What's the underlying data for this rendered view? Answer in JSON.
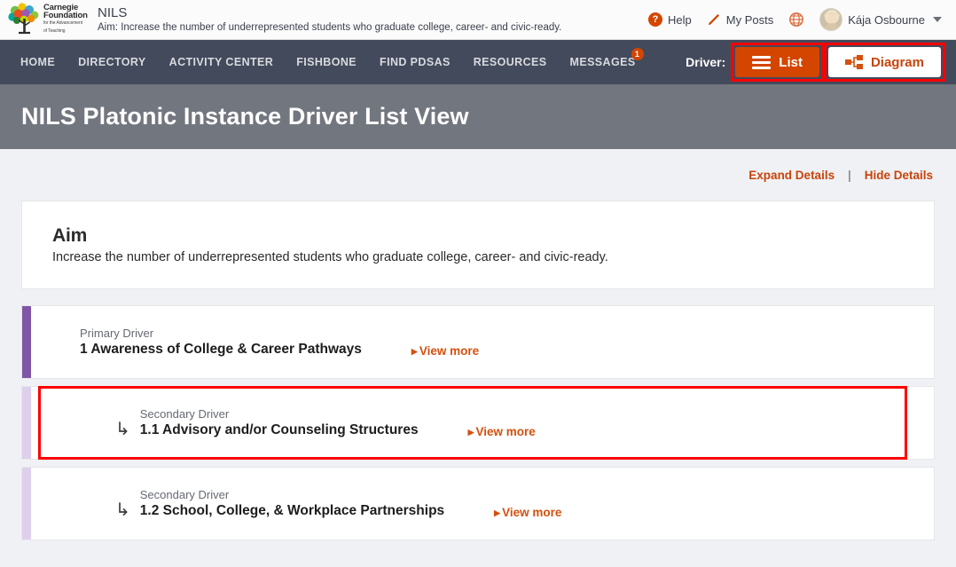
{
  "header": {
    "logo_alt": "Carnegie Foundation for the Advancement of Teaching",
    "logo_line1": "Carnegie",
    "logo_line2": "Foundation",
    "logo_line3": "for the Advancement",
    "logo_line4": "of Teaching",
    "site_title": "NILS",
    "aim_line": "Aim:  Increase the number of underrepresented students who graduate college, career- and civic-ready.",
    "help_label": "Help",
    "help_icon": "question-circle-icon",
    "my_posts_label": "My Posts",
    "my_posts_icon": "pencil-icon",
    "globe_icon": "globe-icon",
    "user_name": "Kája Osbourne",
    "avatar_icon": "user-avatar",
    "caret_icon": "chevron-down-icon"
  },
  "nav": {
    "items": [
      {
        "label": "HOME"
      },
      {
        "label": "DIRECTORY"
      },
      {
        "label": "ACTIVITY CENTER"
      },
      {
        "label": "FISHBONE"
      },
      {
        "label": "FIND PDSAS"
      },
      {
        "label": "RESOURCES"
      },
      {
        "label": "MESSAGES",
        "badge": "1"
      }
    ],
    "driver_label": "Driver:",
    "view_buttons": [
      {
        "label": "List",
        "icon": "hamburger-list-icon",
        "active": true
      },
      {
        "label": "Diagram",
        "icon": "org-chart-icon",
        "active": false
      }
    ]
  },
  "banner": {
    "title": "NILS Platonic Instance Driver List View"
  },
  "details_toolbar": {
    "expand_label": "Expand Details",
    "separator": "|",
    "hide_label": "Hide Details"
  },
  "aim_card": {
    "heading": "Aim",
    "text": "Increase the number of underrepresented students who graduate college, career- and civic-ready."
  },
  "drivers": [
    {
      "kind": "Primary Driver",
      "name": "1 Awareness of College & Career Pathways",
      "view_more": "View more",
      "level": "primary",
      "highlighted": false
    },
    {
      "kind": "Secondary Driver",
      "name": "1.1 Advisory and/or Counseling Structures",
      "view_more": "View more",
      "level": "secondary",
      "highlighted": true
    },
    {
      "kind": "Secondary Driver",
      "name": "1.2 School, College, & Workplace Partnerships",
      "view_more": "View more",
      "level": "secondary",
      "highlighted": false
    }
  ],
  "colors": {
    "accent_orange": "#d44500",
    "nav_dark": "#434a5c",
    "banner_gray": "#72767f",
    "primary_accent_purple": "#8155a5",
    "secondary_accent_purple": "#ded0ec",
    "highlight_red": "#ff0000",
    "page_bg": "#f0f1f4"
  }
}
